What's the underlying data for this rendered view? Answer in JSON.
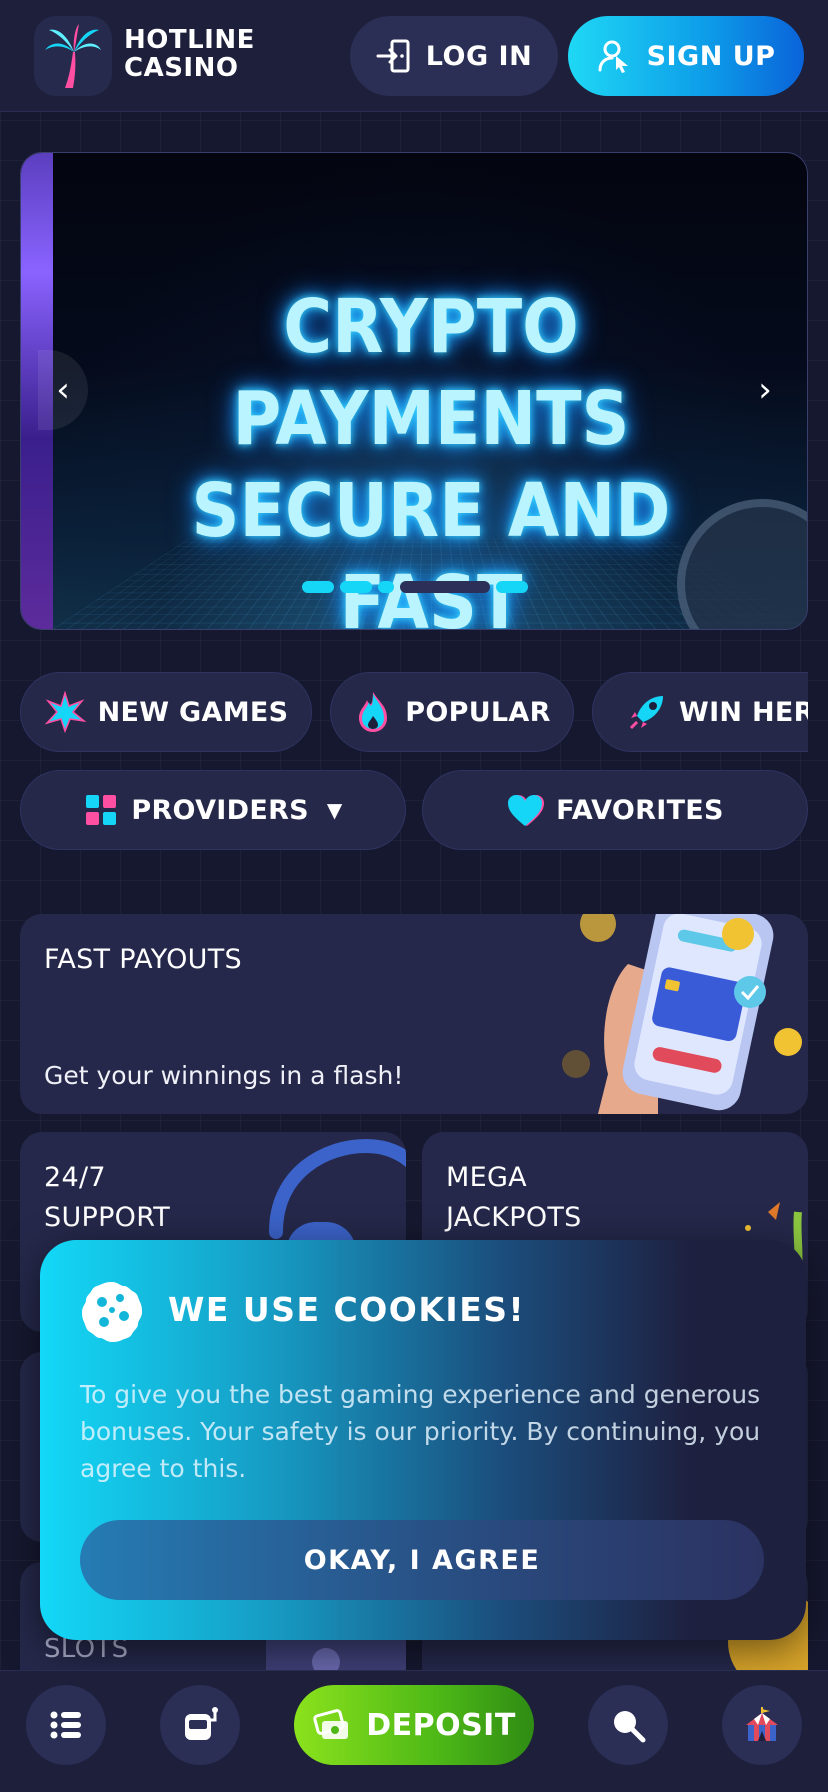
{
  "header": {
    "logo_line1": "HOTLINE",
    "logo_line2": "CASINO",
    "login_label": "LOG IN",
    "signup_label": "SIGN UP"
  },
  "banner": {
    "line1": "CRYPTO PAYMENTS",
    "line2": "SECURE AND FAST",
    "slide_count": 5,
    "active_slide": 2
  },
  "categories": [
    {
      "label": "NEW GAMES",
      "icon": "sparkle-icon"
    },
    {
      "label": "POPULAR",
      "icon": "flame-icon"
    },
    {
      "label": "WIN HERE",
      "icon": "rocket-icon"
    }
  ],
  "filters": {
    "providers_label": "PROVIDERS",
    "favorites_label": "FAVORITES"
  },
  "features": {
    "fast_payouts": {
      "title": "FAST PAYOUTS",
      "subtitle": "Get your winnings in a flash!"
    },
    "support": {
      "title_line1": "24/7",
      "title_line2": "SUPPORT"
    },
    "jackpots": {
      "title_line1": "MEGA",
      "title_line2": "JACKPOTS"
    },
    "slots": {
      "title": "SLOTS"
    }
  },
  "cookie": {
    "title": "WE USE COOKIES!",
    "text": "To give you the best gaming experience and generous bonuses. Your safety is our priority. By continuing, you agree to this.",
    "button_label": "OKAY, I AGREE"
  },
  "bottom_nav": {
    "deposit_label": "DEPOSIT"
  },
  "colors": {
    "accent_cyan": "#16d6f8",
    "accent_pink": "#ff4fa3",
    "deposit_green": "#6fd11a",
    "background": "#161830",
    "panel": "#25284a"
  }
}
